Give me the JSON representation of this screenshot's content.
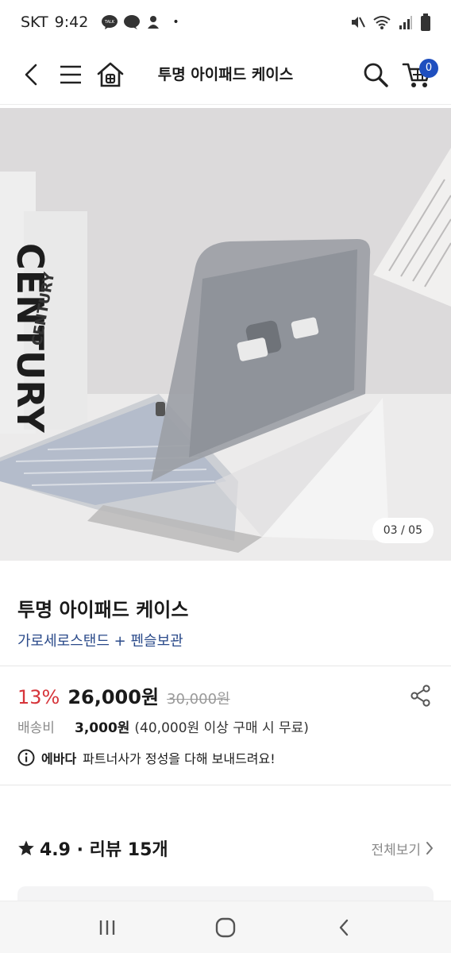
{
  "status_bar": {
    "carrier": "SKT",
    "time": "9:42",
    "notification_icons": [
      "talk-icon",
      "chat-bubble-icon",
      "character-icon"
    ],
    "dot": "•",
    "right_icons": [
      "mute-icon",
      "wifi-icon",
      "signal-icon",
      "battery-icon"
    ]
  },
  "header": {
    "title": "투명 아이패드 케이스",
    "cart_count": "0",
    "accent_color": "#1f4fbf"
  },
  "hero": {
    "counter": "03 / 05",
    "book_text_1": "CENTURY",
    "book_text_2": "CENTURY"
  },
  "product": {
    "name": "투명 아이패드 케이스",
    "option": "가로세로스탠드 + 펜슬보관",
    "discount": "13%",
    "price": "26,000원",
    "original_price": "30,000원",
    "shipping_label": "배송비",
    "shipping_fee": "3,000원",
    "shipping_note": "(40,000원 이상 구매 시 무료)",
    "seller_name": "에바다",
    "seller_message": "파트너사가 정성을 다해 보내드려요!",
    "discount_color": "#d6343a"
  },
  "reviews": {
    "summary": "4.9 · 리뷰 15개",
    "view_all": "전체보기"
  }
}
